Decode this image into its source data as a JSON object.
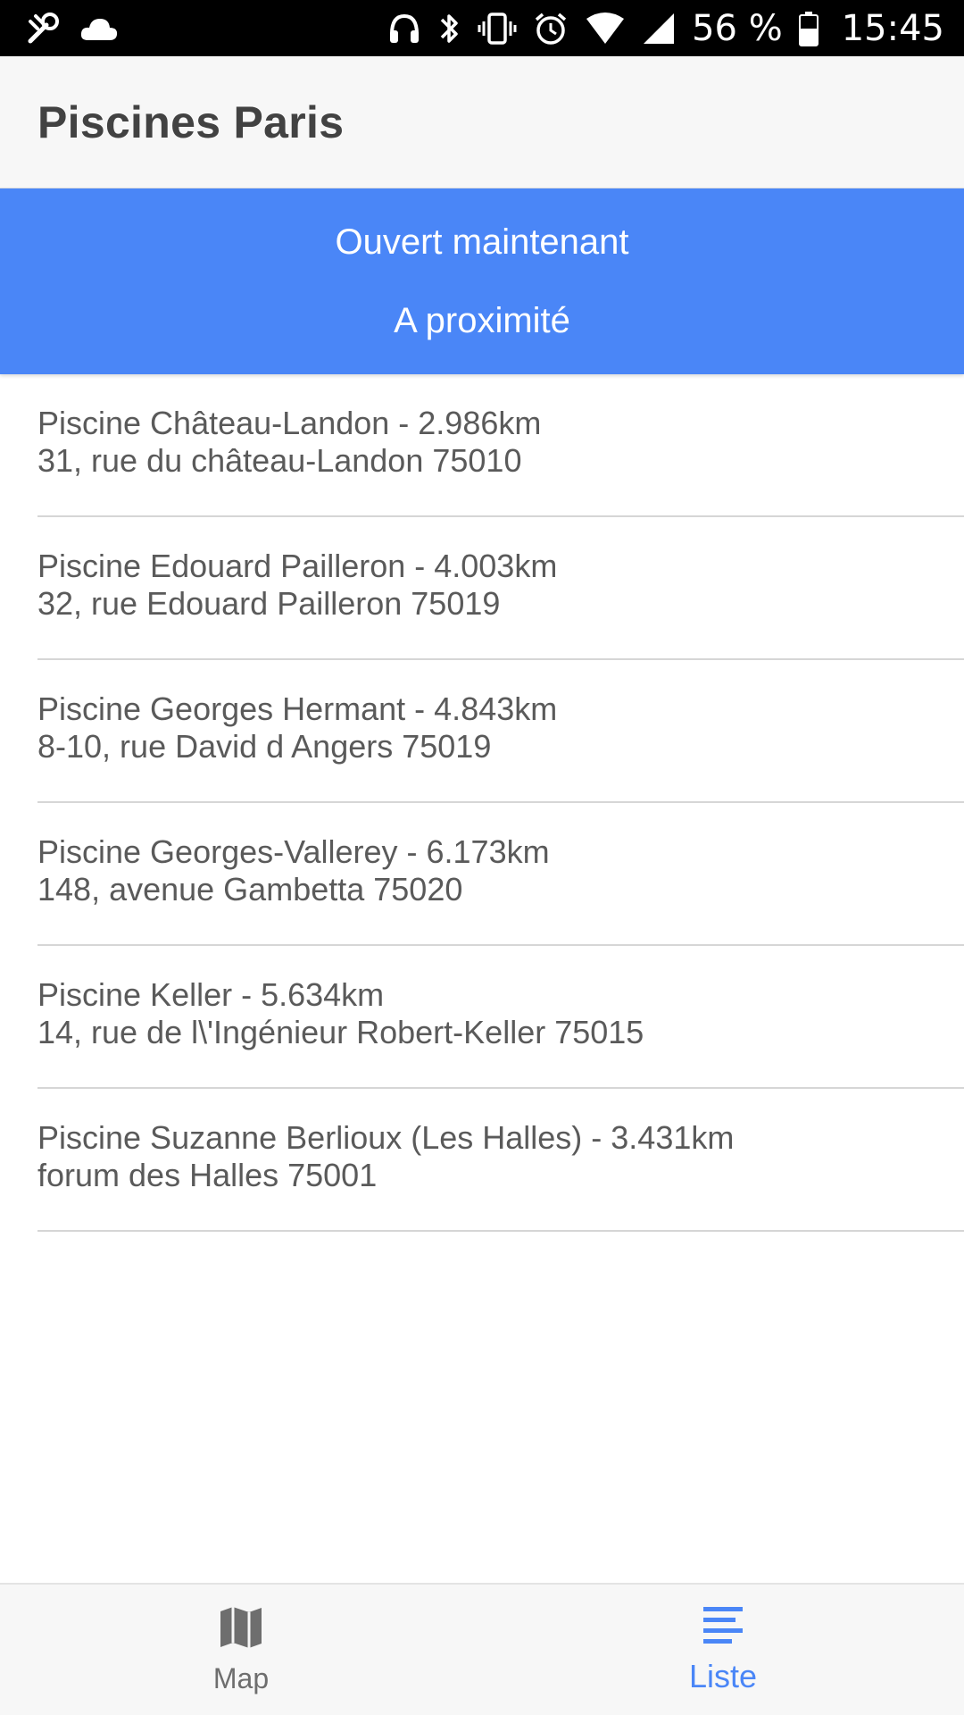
{
  "status_bar": {
    "icons_left": [
      "tools-icon",
      "cloud-icon"
    ],
    "icons_right": [
      "headphones-icon",
      "bluetooth-icon",
      "vibrate-icon",
      "alarm-icon",
      "wifi-icon",
      "signal-icon",
      "battery-icon"
    ],
    "battery": "56 %",
    "time": "15:45"
  },
  "app_bar": {
    "title": "Piscines Paris"
  },
  "filters": {
    "open_now": "Ouvert maintenant",
    "nearby": "A proximité",
    "color": "#4a86f7"
  },
  "pools": [
    {
      "name_distance": "Piscine Château-Landon - 2.986km",
      "address": "31, rue du château-Landon 75010"
    },
    {
      "name_distance": "Piscine Edouard Pailleron - 4.003km",
      "address": "32, rue Edouard Pailleron 75019"
    },
    {
      "name_distance": "Piscine Georges Hermant - 4.843km",
      "address": "8-10, rue David d Angers 75019"
    },
    {
      "name_distance": "Piscine Georges-Vallerey - 6.173km",
      "address": "148, avenue Gambetta 75020"
    },
    {
      "name_distance": "Piscine Keller - 5.634km",
      "address": "14, rue de l\\'Ingénieur Robert-Keller 75015"
    },
    {
      "name_distance": "Piscine Suzanne Berlioux (Les Halles) - 3.431km",
      "address": "forum des Halles 75001"
    }
  ],
  "bottom_nav": {
    "map_label": "Map",
    "list_label": "Liste",
    "active_tab": "Liste",
    "active_color": "#4a86f7"
  }
}
